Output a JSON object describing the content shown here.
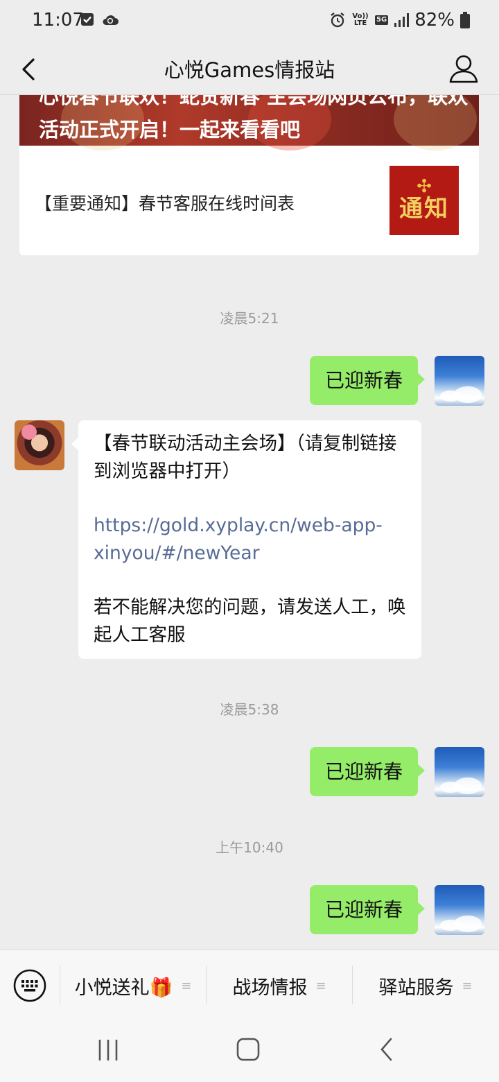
{
  "status_bar": {
    "time": "11:07",
    "battery": "82%",
    "network": "5G",
    "volte": "Vo)) LTE"
  },
  "header": {
    "title": "心悦Games情报站"
  },
  "article": {
    "banner_text": "心悦春节联欢！蛇贺新春 主会场网页公布，联欢活动正式开启！一起来看看吧",
    "notice_title": "【重要通知】春节客服在线时间表",
    "thumb_text": "通知"
  },
  "messages": {
    "ts1": "凌晨5:21",
    "me1": "已迎新春",
    "bot_line1": "【春节联动活动主会场】（请复制链接到浏览器中打开）",
    "bot_link": "https://gold.xyplay.cn/web-app-xinyou/#/newYear",
    "bot_line2": "若不能解决您的问题，请发送人工，唤起人工客服",
    "ts2": "凌晨5:38",
    "me2": "已迎新春",
    "ts3": "上午10:40",
    "me3": "已迎新春"
  },
  "menu": {
    "item1": "小悦送礼🎁",
    "item2": "战场情报",
    "item3": "驿站服务"
  }
}
